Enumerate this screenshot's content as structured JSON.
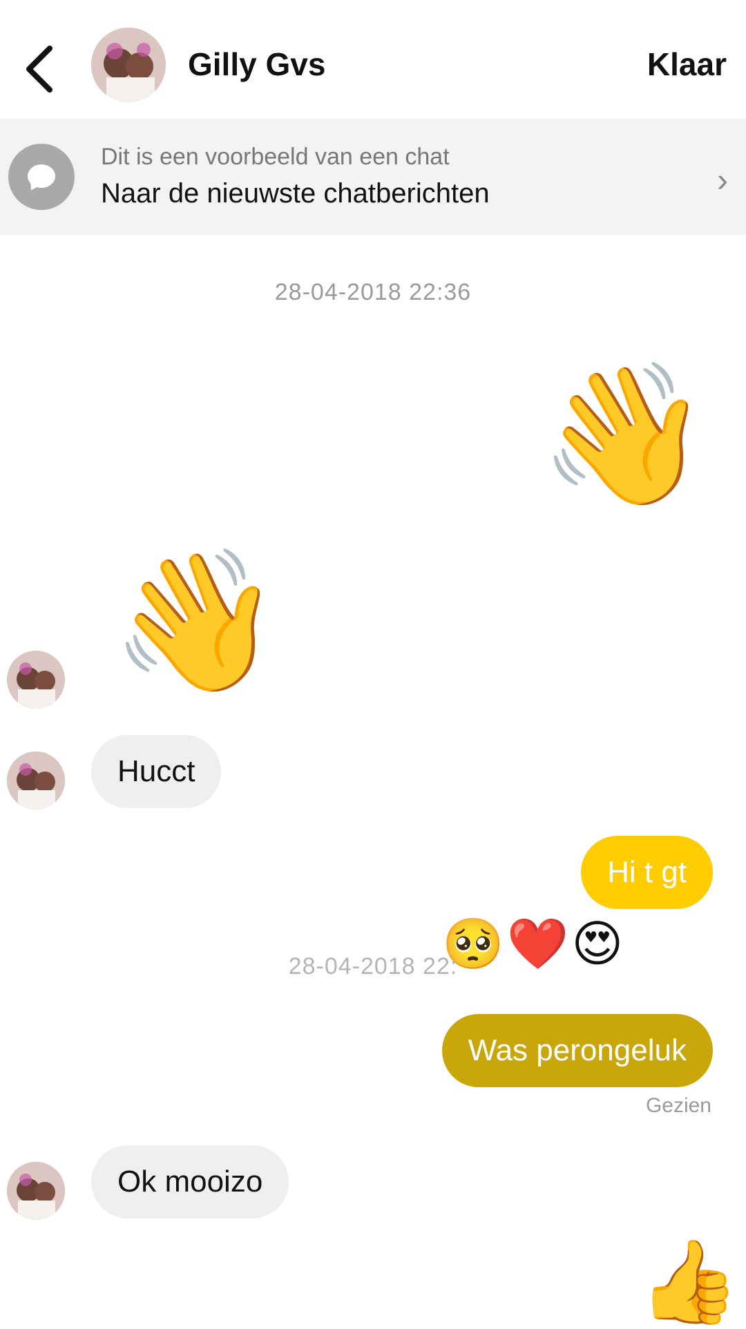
{
  "header": {
    "back_icon": "chevron-left-icon",
    "contact_name": "Gilly Gvs",
    "done_label": "Klaar"
  },
  "banner": {
    "icon": "chat-bubble-icon",
    "subtitle": "Dit is een voorbeeld van een chat",
    "title": "Naar de nieuwste chatberichten",
    "chevron_icon": "chevron-right-icon"
  },
  "messages": {
    "timestamp_1": "28-04-2018 22:36",
    "wave_out": "👋",
    "wave_in": "👋",
    "in_1": "Hucct",
    "out_1": "Hi t gt",
    "timestamp_2": "28-04-2018 22:",
    "reactions": "🥺❤️😍",
    "out_2": "Was perongeluk",
    "seen_label": "Gezien",
    "in_2": "Ok mooizo",
    "thumb": "👍"
  },
  "colors": {
    "accent": "#ffcc00",
    "accent_dark": "#c9a70b",
    "bubble_in": "#efefef",
    "banner_bg": "#f3f3f3"
  }
}
